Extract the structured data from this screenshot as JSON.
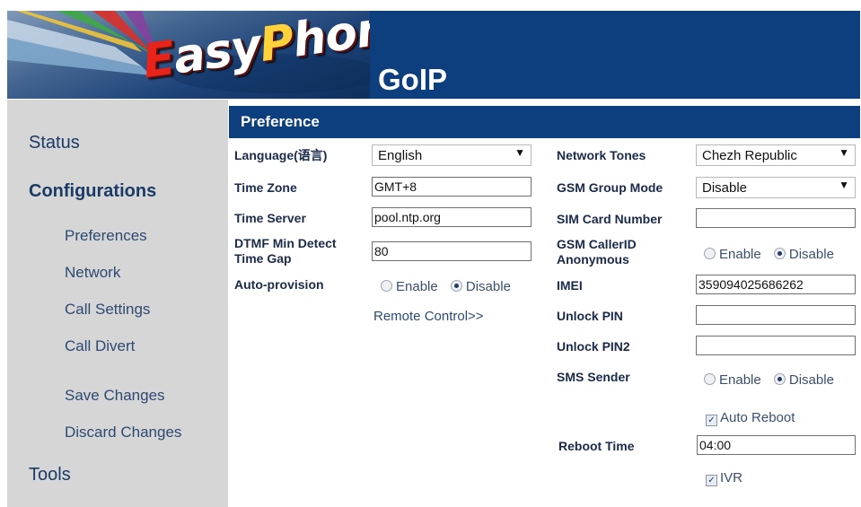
{
  "brand": {
    "logo_text_e": "E",
    "logo_text_mid": "asy",
    "logo_text_p": "P",
    "logo_text_end": "hone",
    "product": "GoIP"
  },
  "sidebar": {
    "status": "Status",
    "configurations": "Configurations",
    "items": [
      "Preferences",
      "Network",
      "Call Settings",
      "Call Divert"
    ],
    "save": "Save Changes",
    "discard": "Discard Changes",
    "tools": "Tools"
  },
  "section_title": "Preference",
  "left": {
    "language_label": "Language(语言)",
    "language_value": "English",
    "timezone_label": "Time Zone",
    "timezone_value": "GMT+8",
    "timeserver_label": "Time Server",
    "timeserver_value": "pool.ntp.org",
    "dtmf_label_1": "DTMF Min Detect",
    "dtmf_label_2": "Time Gap",
    "dtmf_value": "80",
    "autoprov_label": "Auto-provision",
    "enable": "Enable",
    "disable": "Disable",
    "remote_control": "Remote Control>>"
  },
  "right": {
    "network_tones_label": "Network Tones",
    "network_tones_value": "Chezh Republic",
    "gsm_group_label": "GSM Group Mode",
    "gsm_group_value": "Disable",
    "sim_label": "SIM Card Number",
    "sim_value": "",
    "callerid_label_1": "GSM CallerID",
    "callerid_label_2": "Anonymous",
    "imei_label": "IMEI",
    "imei_value": "359094025686262",
    "unlock_pin_label": "Unlock PIN",
    "unlock_pin_value": "",
    "unlock_pin2_label": "Unlock PIN2",
    "unlock_pin2_value": "",
    "sms_sender_label": "SMS Sender",
    "enable": "Enable",
    "disable": "Disable",
    "auto_reboot": "Auto Reboot",
    "reboot_time_label": "Reboot Time",
    "reboot_time_value": "04:00",
    "ivr": "IVR"
  },
  "colors": {
    "banner": "#0d3f7e",
    "sidebar": "#d6d6d6",
    "nav_text": "#1a3b66"
  }
}
